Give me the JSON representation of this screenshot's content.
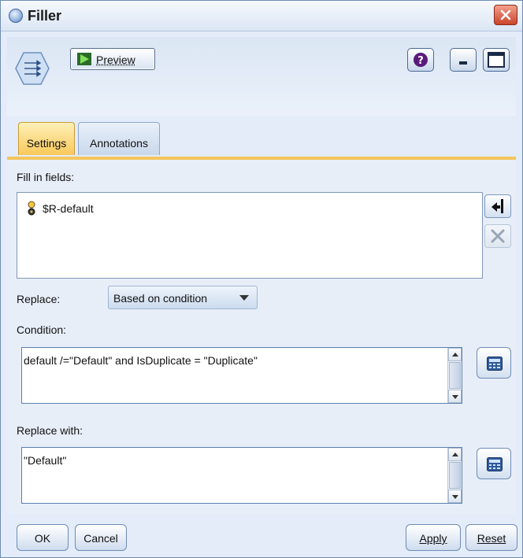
{
  "window": {
    "title": "Filler"
  },
  "toolbar": {
    "preview_label": "Preview",
    "help_icon": "help-icon",
    "minimize_icon": "minimize-icon",
    "maximize_icon": "maximize-icon"
  },
  "tabs": [
    {
      "label": "Settings",
      "active": true
    },
    {
      "label": "Annotations",
      "active": false
    }
  ],
  "settings": {
    "fill_in_fields_label": "Fill in fields:",
    "fields": [
      {
        "name": "$R-default",
        "icon": "flag-field-icon"
      }
    ],
    "replace_label": "Replace:",
    "replace_value": "Based on condition",
    "condition_label": "Condition:",
    "condition_value": "default /=\"Default\" and IsDuplicate  = \"Duplicate\"",
    "replace_with_label": "Replace with:",
    "replace_with_value": "\"Default\""
  },
  "buttons": {
    "ok": "OK",
    "cancel": "Cancel",
    "apply": "Apply",
    "reset": "Reset"
  },
  "colors": {
    "active_tab": "#f8c95a",
    "close_button": "#c9452b",
    "accent": "#5c7fae"
  }
}
